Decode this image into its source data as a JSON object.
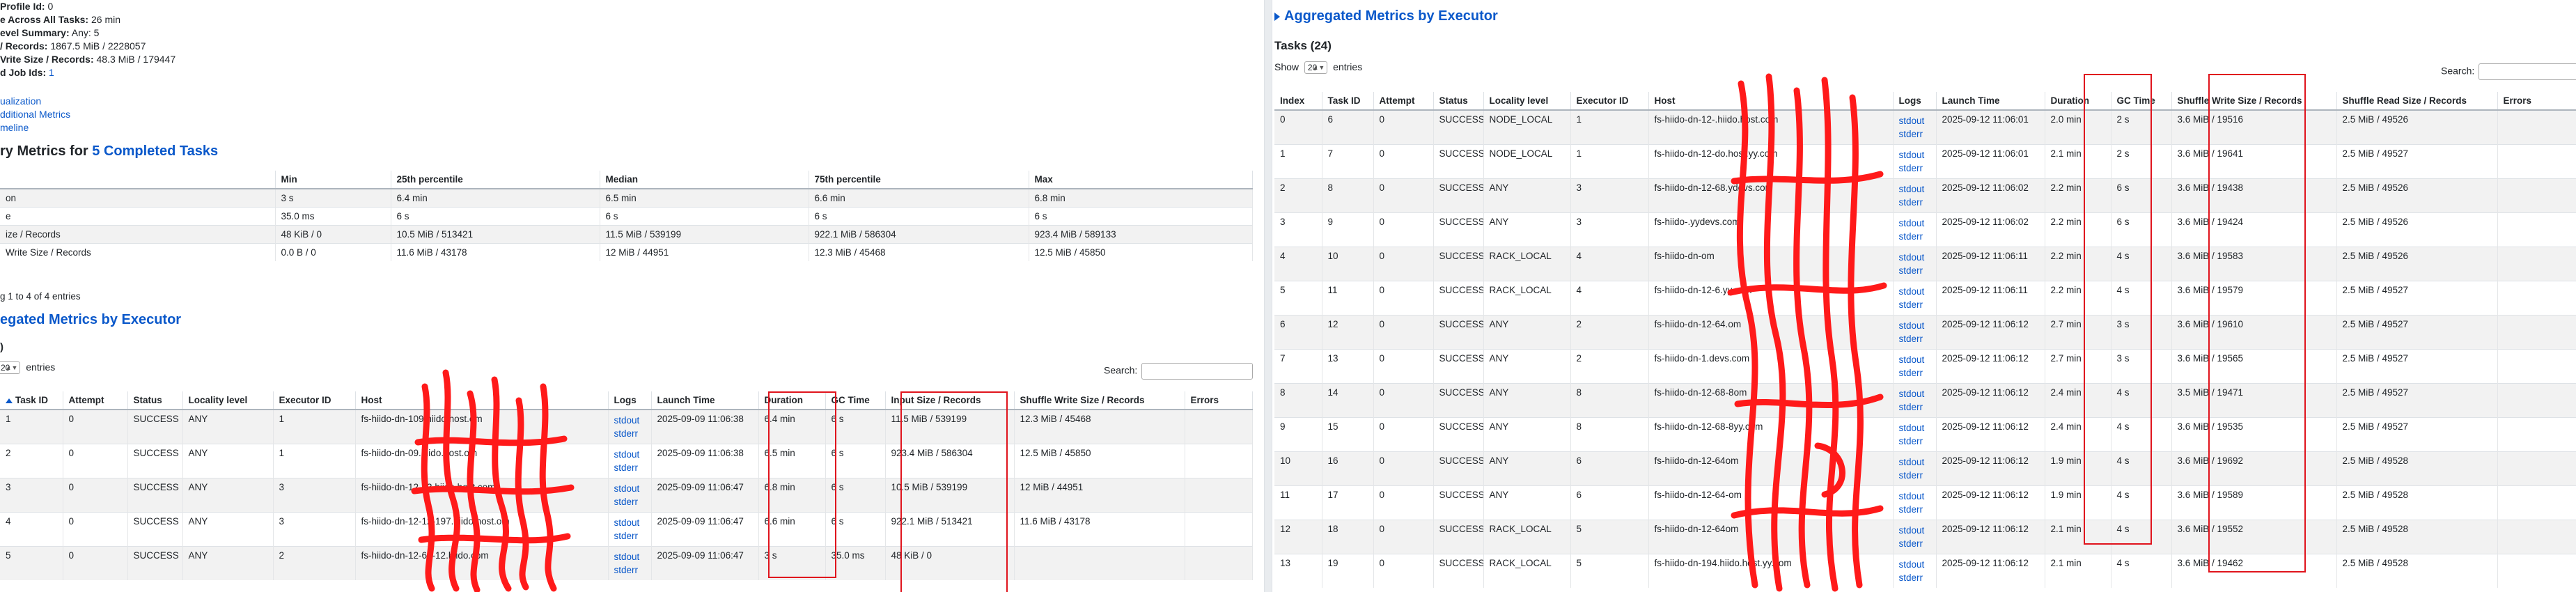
{
  "left": {
    "summary": [
      {
        "label": "Profile Id:",
        "value": "0"
      },
      {
        "label": "e Across All Tasks:",
        "value": "26 min"
      },
      {
        "label": "evel Summary:",
        "value": "Any: 5"
      },
      {
        "label": "/ Records:",
        "value": "1867.5 MiB / 2228057"
      },
      {
        "label": "Vrite Size / Records:",
        "value": "48.3 MiB / 179447"
      },
      {
        "label": "d Job Ids:",
        "value": "1"
      }
    ],
    "links": [
      "ualization",
      "dditional Metrics",
      "meline"
    ],
    "summary_metrics": {
      "heading_prefix": "ry Metrics for ",
      "heading_link": "5 Completed Tasks",
      "headers": [
        "",
        "Min",
        "25th percentile",
        "Median",
        "75th percentile",
        "Max"
      ],
      "rows": [
        [
          "on",
          "3 s",
          "6.4 min",
          "6.5 min",
          "6.6 min",
          "6.8 min"
        ],
        [
          "e",
          "35.0 ms",
          "6 s",
          "6 s",
          "6 s",
          "6 s"
        ],
        [
          "ize / Records",
          "48 KiB / 0",
          "10.5 MiB / 513421",
          "11.5 MiB / 539199",
          "922.1 MiB / 586304",
          "923.4 MiB / 589133"
        ],
        [
          "Write Size / Records",
          "0.0 B / 0",
          "11.6 MiB / 43178",
          "12 MiB / 44951",
          "12.3 MiB / 45468",
          "12.5 MiB / 45850"
        ]
      ],
      "footer": "g 1 to 4 of 4 entries"
    },
    "exec_heading": "egated Metrics by Executor",
    "tasks_label": ")",
    "show_value": "20",
    "show_suffix": "entries",
    "search_label": "Search:",
    "tasks": {
      "headers": [
        "Task ID",
        "Attempt",
        "Status",
        "Locality level",
        "Executor ID",
        "Host",
        "Logs",
        "Launch Time",
        "Duration",
        "GC Time",
        "Input Size / Records",
        "Shuffle Write Size / Records",
        "Errors"
      ],
      "rows": [
        [
          "1",
          "0",
          "SUCCESS",
          "ANY",
          "1",
          "fs-hiido-dn-1",
          "09.hiido.host.",
          "om",
          "stdout",
          "stderr",
          "2025-09-09 11:06:38",
          "6.4 min",
          "6 s",
          "11.5 MiB / 539199",
          "12.3 MiB / 45468",
          ""
        ],
        [
          "2",
          "0",
          "SUCCESS",
          "ANY",
          "1",
          "fs-hiido-dn-",
          "09.hiido.host.",
          "om",
          "stdout",
          "stderr",
          "2025-09-09 11:06:38",
          "6.5 min",
          "6 s",
          "923.4 MiB / 586304",
          "12.5 MiB / 45850",
          ""
        ],
        [
          "3",
          "0",
          "SUCCESS",
          "ANY",
          "3",
          "fs-hiido-dn-1",
          "2-13.hiido.host.",
          "com",
          "stdout",
          "stderr",
          "2025-09-09 11:06:47",
          "6.8 min",
          "6 s",
          "10.5 MiB / 539199",
          "12 MiB / 44951",
          ""
        ],
        [
          "4",
          "0",
          "SUCCESS",
          "ANY",
          "3",
          "fs-hiido-dn-1",
          "2-12-197.hiido.host.",
          "om",
          "stdout",
          "stderr",
          "2025-09-09 11:06:47",
          "6.6 min",
          "6 s",
          "922.1 MiB / 513421",
          "11.6 MiB / 43178",
          ""
        ],
        [
          "5",
          "0",
          "SUCCESS",
          "ANY",
          "2",
          "fs-hiido-dn-12-64-12.hiido.",
          "",
          "com",
          "stdout",
          "stderr",
          "2025-09-09 11:06:47",
          "3 s",
          "35.0 ms",
          "48 KiB / 0",
          "",
          ""
        ]
      ]
    }
  },
  "right": {
    "exec_heading": "Aggregated Metrics by Executor",
    "tasks_heading": "Tasks (24)",
    "show_label": "Show",
    "show_value": "20",
    "show_suffix": "entries",
    "search_label": "Search:",
    "tasks": {
      "headers": [
        "Index",
        "Task ID",
        "Attempt",
        "Status",
        "Locality level",
        "Executor ID",
        "Host",
        "Logs",
        "Launch Time",
        "Duration",
        "GC Time",
        "Shuffle Write Size / Records",
        "Shuffle Read Size / Records",
        "Errors"
      ],
      "rows": [
        [
          "0",
          "6",
          "0",
          "SUCCESS",
          "NODE_LOCAL",
          "1",
          "fs-hiido-dn-12-",
          ".hiido.host.",
          "com",
          "stdout",
          "stderr",
          "2025-09-12 11:06:01",
          "2.0 min",
          "2 s",
          "3.6 MiB / 19516",
          "2.5 MiB / 49526",
          ""
        ],
        [
          "1",
          "7",
          "0",
          "SUCCESS",
          "NODE_LOCAL",
          "1",
          "fs-hiido-dn-12-",
          "do.host.yy.",
          "com",
          "stdout",
          "stderr",
          "2025-09-12 11:06:01",
          "2.1 min",
          "2 s",
          "3.6 MiB / 19641",
          "2.5 MiB / 49527",
          ""
        ],
        [
          "2",
          "8",
          "0",
          "SUCCESS",
          "ANY",
          "3",
          "fs-hiido-dn-12-68.",
          "ydevs.",
          "com",
          "stdout",
          "stderr",
          "2025-09-12 11:06:02",
          "2.2 min",
          "6 s",
          "3.6 MiB / 19438",
          "2.5 MiB / 49526",
          ""
        ],
        [
          "3",
          "9",
          "0",
          "SUCCESS",
          "ANY",
          "3",
          "fs-hiido-",
          ".yydevs.",
          "com",
          "stdout",
          "stderr",
          "2025-09-12 11:06:02",
          "2.2 min",
          "6 s",
          "3.6 MiB / 19424",
          "2.5 MiB / 49526",
          ""
        ],
        [
          "4",
          "10",
          "0",
          "SUCCESS",
          "RACK_LOCAL",
          "4",
          "fs-hiido-dn-",
          "",
          "om",
          "stdout",
          "stderr",
          "2025-09-12 11:06:11",
          "2.2 min",
          "4 s",
          "3.6 MiB / 19583",
          "2.5 MiB / 49526",
          ""
        ],
        [
          "5",
          "11",
          "0",
          "SUCCESS",
          "RACK_LOCAL",
          "4",
          "fs-hiido-dn-12-6",
          ".yy.",
          "com",
          "stdout",
          "stderr",
          "2025-09-12 11:06:11",
          "2.2 min",
          "4 s",
          "3.6 MiB / 19579",
          "2.5 MiB / 49527",
          ""
        ],
        [
          "6",
          "12",
          "0",
          "SUCCESS",
          "ANY",
          "2",
          "fs-hiido-dn-12-64.",
          "",
          "om",
          "stdout",
          "stderr",
          "2025-09-12 11:06:12",
          "2.7 min",
          "3 s",
          "3.6 MiB / 19610",
          "2.5 MiB / 49527",
          ""
        ],
        [
          "7",
          "13",
          "0",
          "SUCCESS",
          "ANY",
          "2",
          "fs-hiido-dn-1",
          ".devs.",
          "com",
          "stdout",
          "stderr",
          "2025-09-12 11:06:12",
          "2.7 min",
          "3 s",
          "3.6 MiB / 19565",
          "2.5 MiB / 49527",
          ""
        ],
        [
          "8",
          "14",
          "0",
          "SUCCESS",
          "ANY",
          "8",
          "fs-hiido-dn-12-68-8",
          "",
          "om",
          "stdout",
          "stderr",
          "2025-09-12 11:06:12",
          "2.4 min",
          "4 s",
          "3.5 MiB / 19471",
          "2.5 MiB / 49527",
          ""
        ],
        [
          "9",
          "15",
          "0",
          "SUCCESS",
          "ANY",
          "8",
          "fs-hiido-dn-12-68-8",
          "yy.",
          "com",
          "stdout",
          "stderr",
          "2025-09-12 11:06:12",
          "2.4 min",
          "4 s",
          "3.6 MiB / 19535",
          "2.5 MiB / 49527",
          ""
        ],
        [
          "10",
          "16",
          "0",
          "SUCCESS",
          "ANY",
          "6",
          "fs-hiido-dn-12-64",
          "",
          "om",
          "stdout",
          "stderr",
          "2025-09-12 11:06:12",
          "1.9 min",
          "4 s",
          "3.6 MiB / 19692",
          "2.5 MiB / 49528",
          ""
        ],
        [
          "11",
          "17",
          "0",
          "SUCCESS",
          "ANY",
          "6",
          "fs-hiido-dn-12-64-",
          "",
          "om",
          "stdout",
          "stderr",
          "2025-09-12 11:06:12",
          "1.9 min",
          "4 s",
          "3.6 MiB / 19589",
          "2.5 MiB / 49528",
          ""
        ],
        [
          "12",
          "18",
          "0",
          "SUCCESS",
          "RACK_LOCAL",
          "5",
          "fs-hiido-dn-12-64",
          "",
          "om",
          "stdout",
          "stderr",
          "2025-09-12 11:06:12",
          "2.1 min",
          "4 s",
          "3.6 MiB / 19552",
          "2.5 MiB / 49528",
          ""
        ],
        [
          "13",
          "19",
          "0",
          "SUCCESS",
          "RACK_LOCAL",
          "5",
          "fs-hiido-dn-1",
          "94.hiido.host.yy.",
          "com",
          "stdout",
          "stderr",
          "2025-09-12 11:06:12",
          "2.1 min",
          "4 s",
          "3.6 MiB / 19462",
          "2.5 MiB / 49528",
          ""
        ]
      ]
    }
  },
  "colors": {
    "link": "#0a58ca",
    "annotation_red": "#e0141d",
    "stripe": "#f2f2f2"
  }
}
